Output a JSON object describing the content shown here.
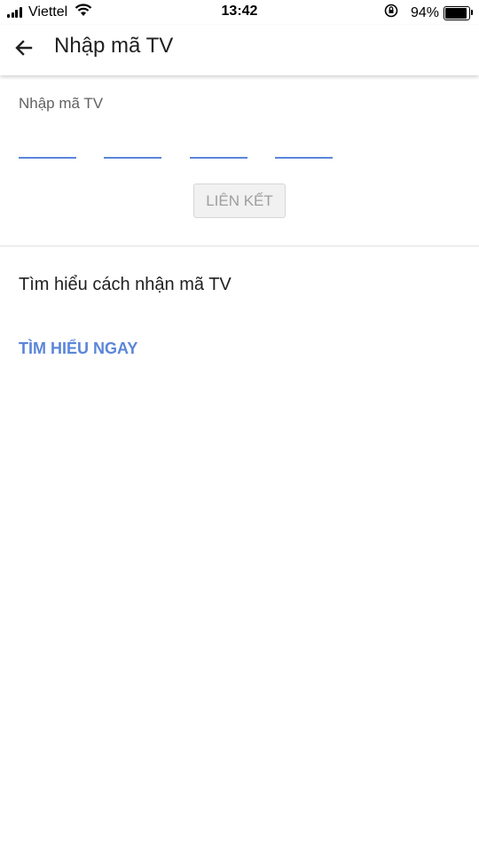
{
  "status_bar": {
    "carrier": "Viettel",
    "time": "13:42",
    "battery_percent": "94%",
    "battery_level": 0.94,
    "icons": [
      "signal-icon",
      "wifi-icon",
      "rotation-lock-icon",
      "battery-icon"
    ]
  },
  "app_bar": {
    "back_icon": "arrow-back-icon",
    "title": "Nhập mã TV"
  },
  "code_entry": {
    "label": "Nhập mã TV",
    "fields": [
      "",
      "",
      "",
      ""
    ],
    "link_button_label": "LIÊN KẾT"
  },
  "learn": {
    "heading": "Tìm hiểu cách nhận mã TV",
    "link_label": "TÌM HIỂU NGAY"
  },
  "colors": {
    "accent": "#5b86d9",
    "text_primary": "#212121",
    "text_secondary": "#616161",
    "button_disabled_bg": "#f1f1f1",
    "button_disabled_text": "#9e9e9e"
  }
}
